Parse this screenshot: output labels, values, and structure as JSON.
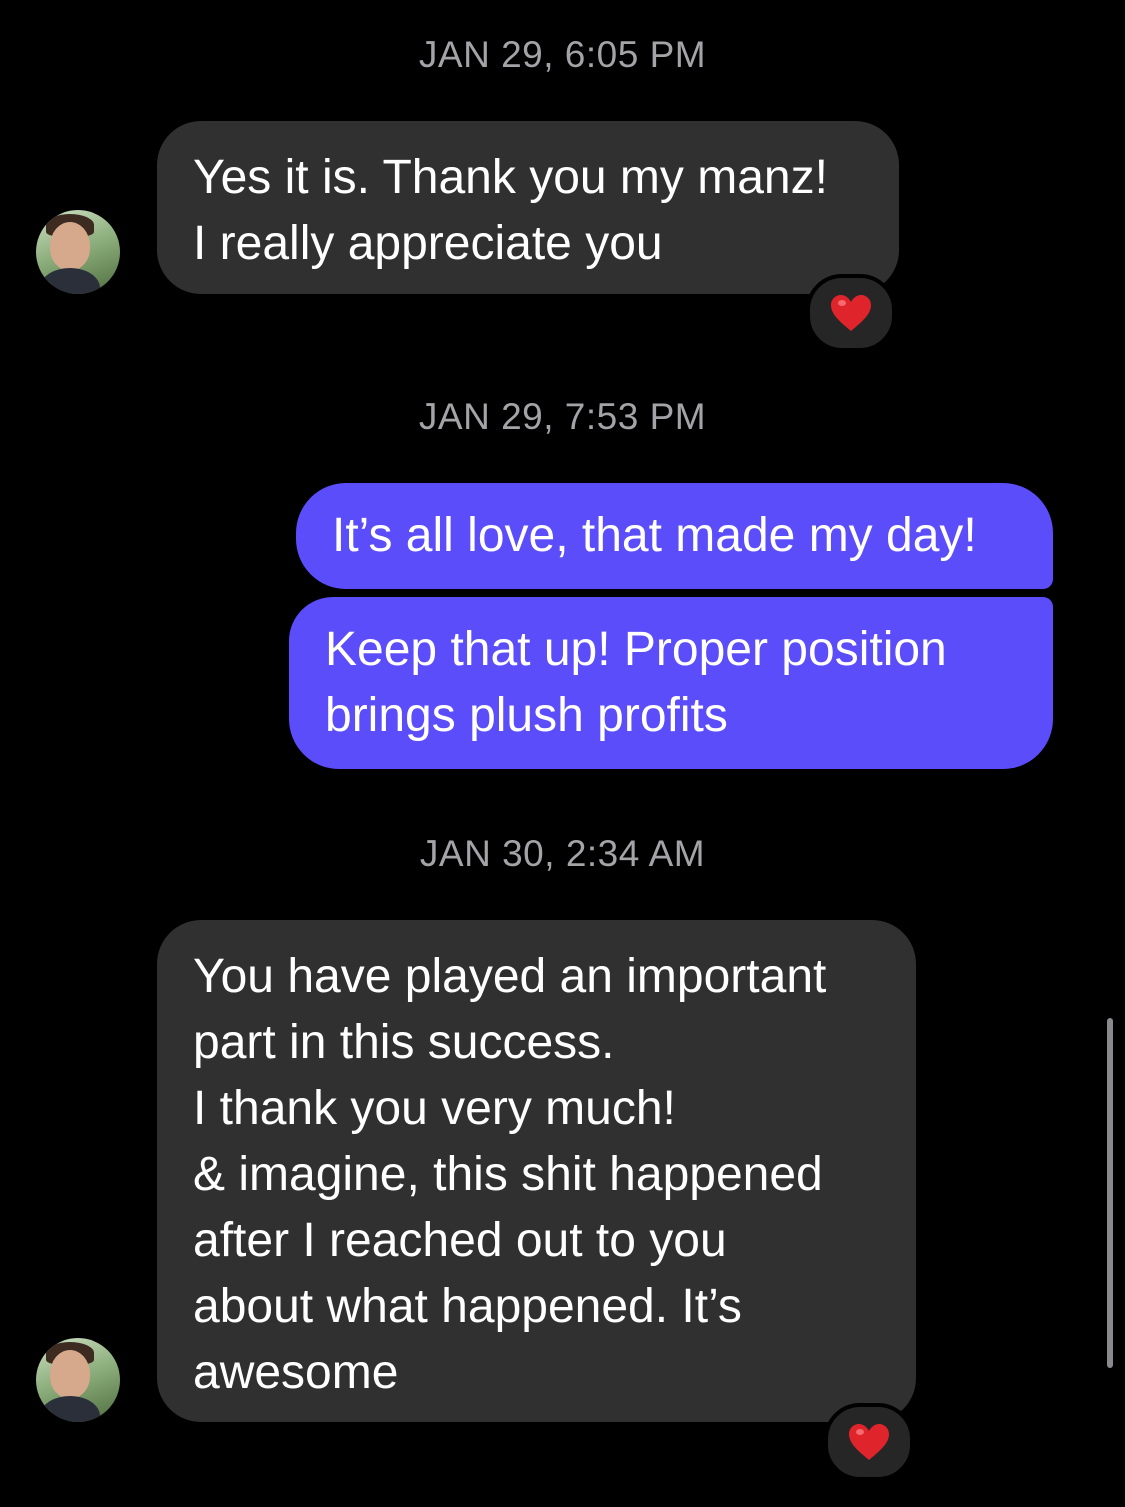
{
  "conversation": {
    "groups": [
      {
        "timestamp": "JAN 29, 6:05 PM",
        "messages": [
          {
            "direction": "incoming",
            "text": "Yes it is. Thank you my manz!\nI really appreciate you",
            "reaction": "❤️"
          }
        ]
      },
      {
        "timestamp": "JAN 29, 7:53 PM",
        "messages": [
          {
            "direction": "outgoing",
            "text": "It’s all love, that made my day!"
          },
          {
            "direction": "outgoing",
            "text": "Keep that up!  Proper position\nbrings plush profits"
          }
        ]
      },
      {
        "timestamp": "JAN 30, 2:34 AM",
        "messages": [
          {
            "direction": "incoming",
            "text": "You have played an important\npart in this success.\nI thank you very much!\n& imagine, this shit happened\nafter I reached out to you\nabout what happened. It’s\nawesome",
            "reaction": "❤️"
          }
        ]
      }
    ]
  },
  "colors": {
    "background": "#000000",
    "incoming_bubble": "#303030",
    "outgoing_bubble": "#5b4dfa",
    "timestamp_text": "#a3a3a8",
    "reaction_heart": "#e0242c"
  },
  "icons": {
    "avatar": "contact-avatar-photo",
    "reaction": "red-heart-icon"
  }
}
